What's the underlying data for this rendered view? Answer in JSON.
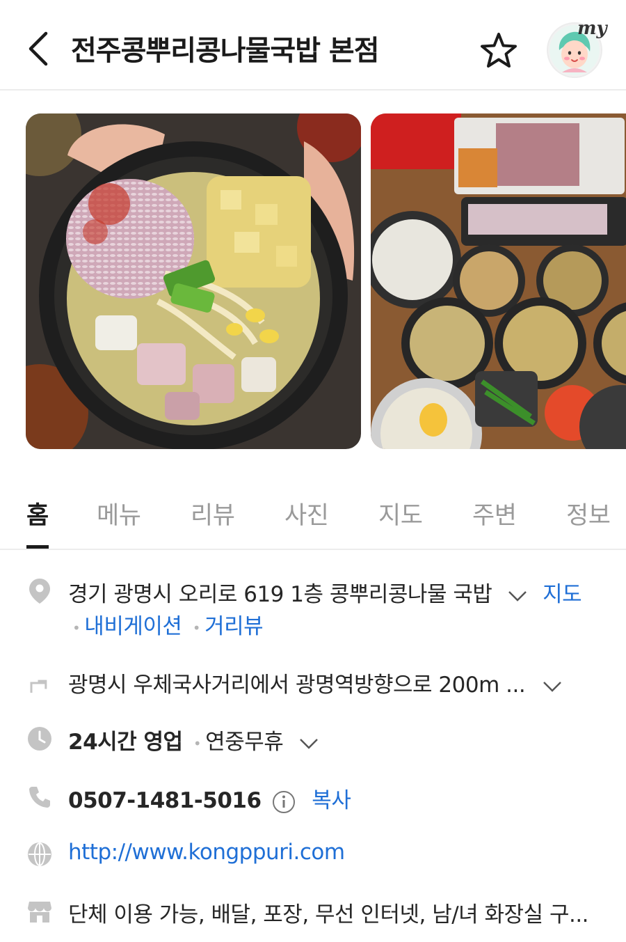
{
  "header": {
    "title": "전주콩뿌리콩나물국밥 본점",
    "avatar_label": "my"
  },
  "tabs": [
    "홈",
    "메뉴",
    "리뷰",
    "사진",
    "지도",
    "주변",
    "정보"
  ],
  "info": {
    "address": "경기 광명시 오리로 619 1층 콩뿌리콩나물 국밥",
    "map_link": "지도",
    "navigation_link": "내비게이션",
    "streetview_link": "거리뷰",
    "directions": "광명시 우체국사거리에서 광명역방향으로 200m ...",
    "hours": "24시간 영업",
    "holiday": "연중무휴",
    "phone": "0507-1481-5016",
    "copy_label": "복사",
    "website": "http://www.kongppuri.com",
    "facilities": "단체 이용 가능, 배달, 포장, 무선 인터넷, 남/녀 화장실 구..."
  },
  "icons": {
    "back": "chevron-left-icon",
    "favorite": "star-icon",
    "address": "map-pin-icon",
    "directions": "turn-arrow-icon",
    "hours": "clock-icon",
    "phone": "phone-icon",
    "website": "globe-icon",
    "facilities": "store-icon"
  },
  "colors": {
    "link": "#1f6fd6",
    "icon_gray": "#c4c4c4",
    "active_tab": "#1b1b1b",
    "inactive_tab": "#9a9a9a"
  }
}
